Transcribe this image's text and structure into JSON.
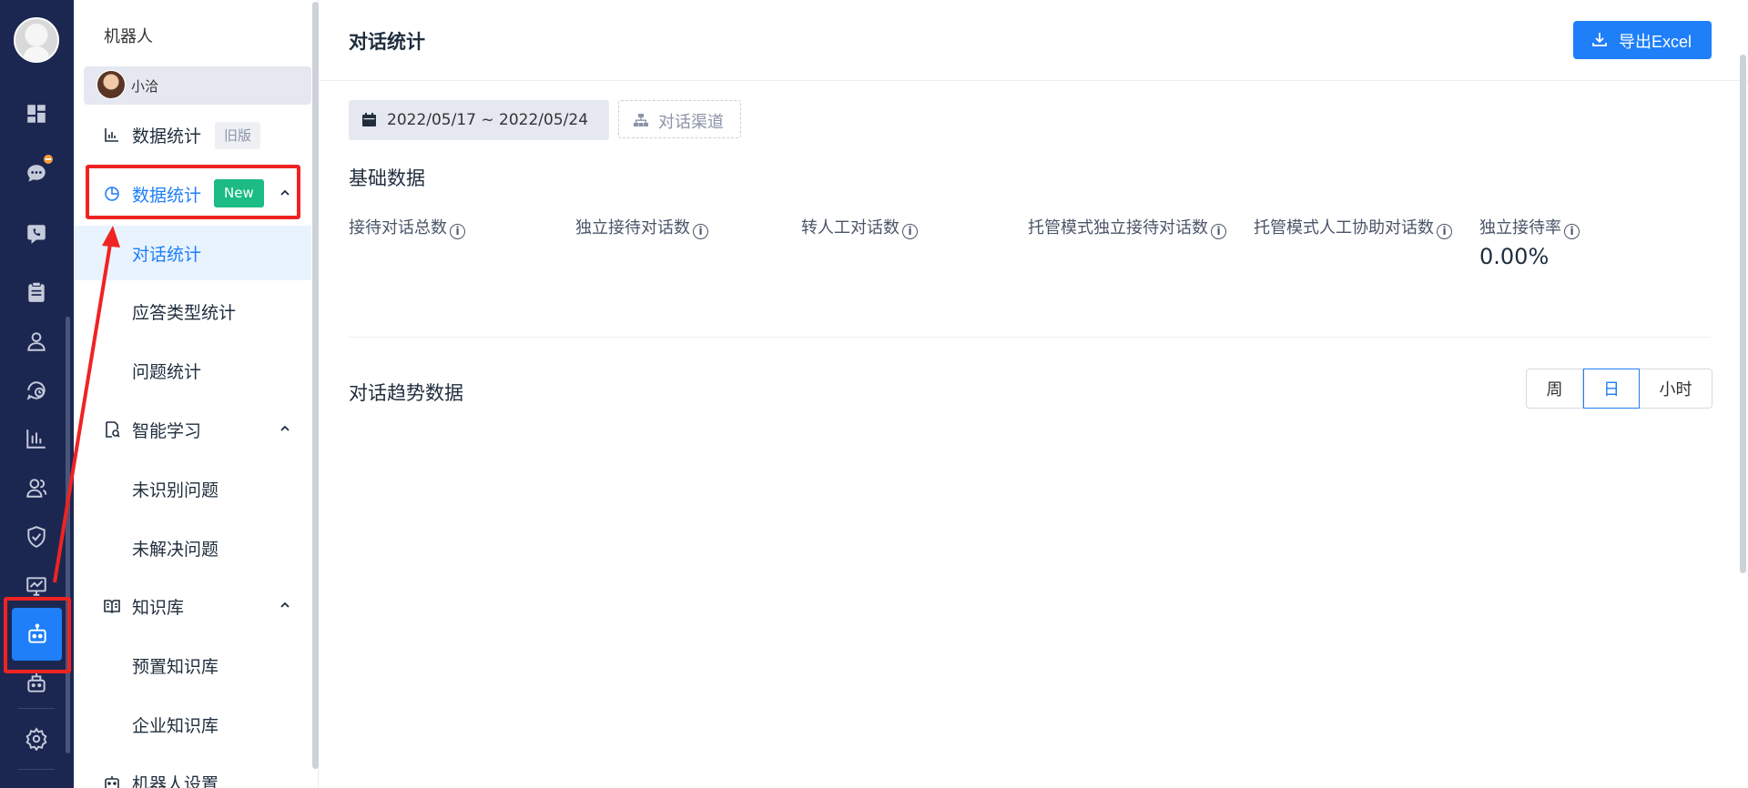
{
  "rail": {
    "icons": [
      "dashboard-icon",
      "chat-icon",
      "phone-chat-icon",
      "clipboard-icon",
      "user-icon",
      "history-icon",
      "bar-chart-icon",
      "team-icon",
      "shield-check-icon",
      "monitor-chart-icon",
      "robot-icon",
      "gift-robot-icon",
      "gear-icon"
    ],
    "active": "robot-icon",
    "badge_color": "#fa9c3b",
    "bg": "#1c2751"
  },
  "sidebar": {
    "title": "机器人",
    "bot_name": "小洽",
    "items": [
      {
        "label": "数据统计",
        "tag": "旧版"
      },
      {
        "label": "数据统计",
        "tag": "New",
        "expanded": true,
        "children": [
          "对话统计",
          "应答类型统计",
          "问题统计"
        ]
      },
      {
        "label": "智能学习",
        "expanded": true,
        "children": [
          "未识别问题",
          "未解决问题"
        ]
      },
      {
        "label": "知识库",
        "expanded": true,
        "children": [
          "预置知识库",
          "企业知识库"
        ]
      },
      {
        "label": "机器人设置"
      }
    ],
    "active_child": "对话统计"
  },
  "header": {
    "title": "对话统计",
    "export_label": "导出Excel"
  },
  "filters": {
    "date_range": "2022/05/17 ~ 2022/05/24",
    "channel_label": "对话渠道"
  },
  "basic": {
    "title": "基础数据",
    "metrics": [
      "接待对话总数",
      "独立接待对话数",
      "转人工对话数",
      "托管模式独立接待对话数",
      "托管模式人工协助对话数",
      "独立接待率"
    ],
    "rate_value": "0.00%"
  },
  "trend": {
    "title": "对话趋势数据",
    "periods": [
      "周",
      "日",
      "小时"
    ],
    "selected": "日"
  },
  "colors": {
    "accent": "#1e7ff8",
    "new_tag": "#1cbc84",
    "annotation": "#f02323"
  }
}
